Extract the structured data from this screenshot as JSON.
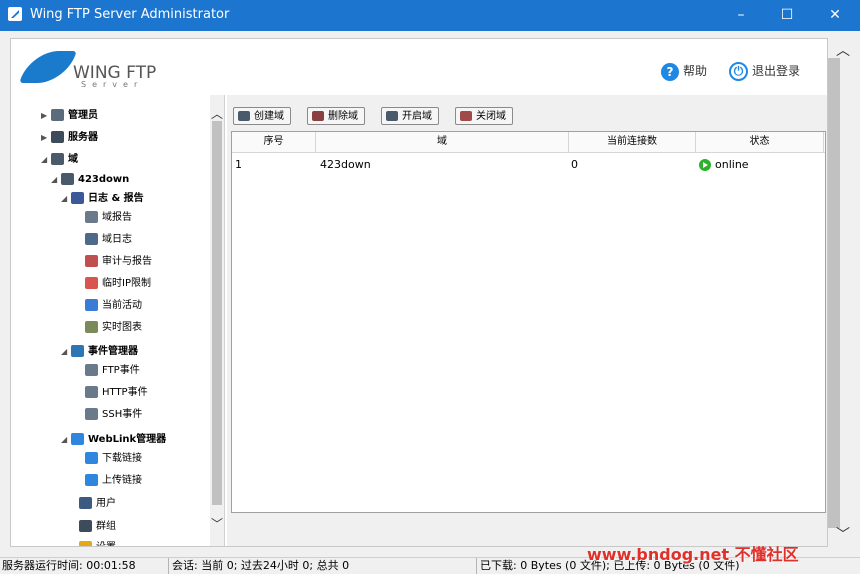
{
  "window": {
    "title": "Wing FTP Server Administrator",
    "minimize_glyph": "–",
    "maximize_glyph": "☐",
    "close_glyph": "✕"
  },
  "header": {
    "logo_name": "WING FTP",
    "logo_sub": "Server",
    "help_label": "帮助",
    "logout_label": "退出登录",
    "help_icon": "question-icon",
    "logout_icon": "power-icon"
  },
  "tree": {
    "items": [
      {
        "label": "管理员",
        "icon": "user-icon",
        "toggle": "▶",
        "color": "#5a6b7c"
      },
      {
        "label": "服务器",
        "icon": "server-icon",
        "toggle": "▶",
        "color": "#3d4b5a"
      },
      {
        "label": "域",
        "icon": "domain-icon",
        "toggle": "◢",
        "color": "#4a5a6a"
      },
      {
        "label": "423down",
        "icon": "domain-icon",
        "toggle": "◢",
        "color": "#4a5a6a"
      },
      {
        "label": "日志 & 报告",
        "icon": "report-icon",
        "toggle": "◢",
        "color": "#3b5998"
      },
      {
        "label": "域报告",
        "icon": "cube-icon",
        "toggle": "",
        "color": "#6a7a8a"
      },
      {
        "label": "域日志",
        "icon": "monitor-icon",
        "toggle": "",
        "color": "#4d6a8a"
      },
      {
        "label": "审计与报告",
        "icon": "document-icon",
        "toggle": "",
        "color": "#c0504d"
      },
      {
        "label": "临时IP限制",
        "icon": "block-icon",
        "toggle": "",
        "color": "#d9534f"
      },
      {
        "label": "当前活动",
        "icon": "activity-icon",
        "toggle": "",
        "color": "#3a7bd5"
      },
      {
        "label": "实时图表",
        "icon": "chart-icon",
        "toggle": "",
        "color": "#7a8a5a"
      },
      {
        "label": "事件管理器",
        "icon": "event-icon",
        "toggle": "◢",
        "color": "#2e75b6"
      },
      {
        "label": "FTP事件",
        "icon": "ftp-icon",
        "toggle": "",
        "color": "#6a7a8a"
      },
      {
        "label": "HTTP事件",
        "icon": "http-icon",
        "toggle": "",
        "color": "#6a7a8a"
      },
      {
        "label": "SSH事件",
        "icon": "ssh-icon",
        "toggle": "",
        "color": "#6a7a8a"
      },
      {
        "label": "WebLink管理器",
        "icon": "globe-icon",
        "toggle": "◢",
        "color": "#2e86de"
      },
      {
        "label": "下载链接",
        "icon": "download-link-icon",
        "toggle": "",
        "color": "#2e86de"
      },
      {
        "label": "上传链接",
        "icon": "upload-link-icon",
        "toggle": "",
        "color": "#2e86de"
      },
      {
        "label": "用户",
        "icon": "users-icon",
        "toggle": "",
        "color": "#3d5a80"
      },
      {
        "label": "群组",
        "icon": "group-icon",
        "toggle": "",
        "color": "#3d4b5a"
      },
      {
        "label": "设置",
        "icon": "settings-icon",
        "toggle": "",
        "color": "#e6a817"
      }
    ]
  },
  "toolbar": {
    "create_label": "创建域",
    "delete_label": "删除域",
    "start_label": "开启域",
    "stop_label": "关闭域"
  },
  "grid": {
    "columns": [
      "序号",
      "域",
      "当前连接数",
      "状态"
    ],
    "rows": [
      {
        "index": "1",
        "domain": "423down",
        "connections": "0",
        "status": "online"
      }
    ]
  },
  "statusbar": {
    "uptime": "服务器运行时间: 00:01:58",
    "sessions": "会话: 当前 0;  过去24小时 0;  总共 0",
    "transfer": "已下载: 0 Bytes (0 文件);  已上传: 0 Bytes (0 文件)"
  },
  "watermark": "www.bndog.net 不懂社区",
  "colors": {
    "titlebar": "#1c76cf",
    "accent": "#1e88e5",
    "online": "#2bb12b"
  }
}
